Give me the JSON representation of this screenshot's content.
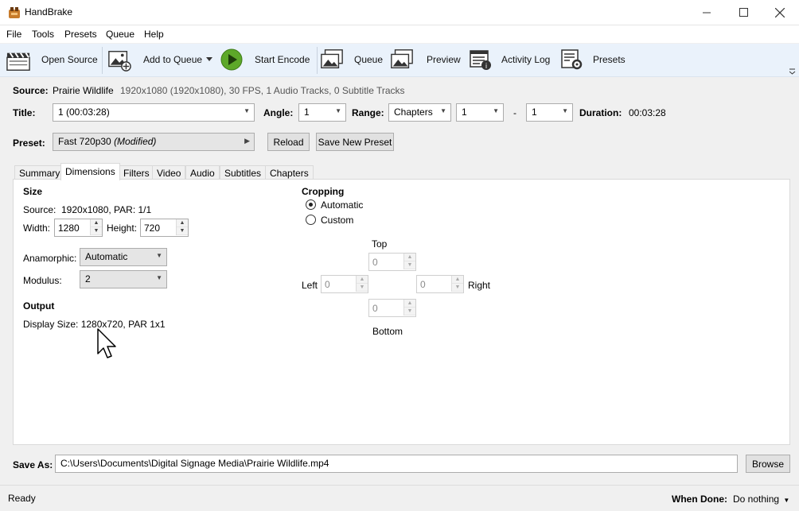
{
  "window": {
    "title": "HandBrake"
  },
  "menu": [
    "File",
    "Tools",
    "Presets",
    "Queue",
    "Help"
  ],
  "toolbar": {
    "open_source": "Open Source",
    "add_to_queue": "Add to Queue",
    "start_encode": "Start Encode",
    "queue": "Queue",
    "preview": "Preview",
    "activity_log": "Activity Log",
    "presets": "Presets"
  },
  "source": {
    "label": "Source:",
    "name": "Prairie Wildlife",
    "info": "1920x1080 (1920x1080), 30 FPS, 1 Audio Tracks, 0 Subtitle Tracks"
  },
  "title_row": {
    "title_label": "Title:",
    "title_value": "1  (00:03:28)",
    "angle_label": "Angle:",
    "angle_value": "1",
    "range_label": "Range:",
    "range_type": "Chapters",
    "range_start": "1",
    "range_dash": "-",
    "range_end": "1",
    "duration_label": "Duration:",
    "duration_value": "00:03:28"
  },
  "preset": {
    "label": "Preset:",
    "name": "Fast 720p30",
    "modified": "(Modified)",
    "reload": "Reload",
    "save_new": "Save New Preset"
  },
  "tabs": [
    "Summary",
    "Dimensions",
    "Filters",
    "Video",
    "Audio",
    "Subtitles",
    "Chapters"
  ],
  "dimensions": {
    "size_heading": "Size",
    "source_label": "Source:",
    "source_value": "1920x1080, PAR: 1/1",
    "width_label": "Width:",
    "width_value": "1280",
    "height_label": "Height:",
    "height_value": "720",
    "anamorphic_label": "Anamorphic:",
    "anamorphic_value": "Automatic",
    "modulus_label": "Modulus:",
    "modulus_value": "2",
    "output_heading": "Output",
    "display_size": "Display Size: 1280x720,  PAR 1x1"
  },
  "cropping": {
    "heading": "Cropping",
    "automatic": "Automatic",
    "custom": "Custom",
    "top_label": "Top",
    "left_label": "Left",
    "right_label": "Right",
    "bottom_label": "Bottom",
    "top_value": "0",
    "left_value": "0",
    "right_value": "0",
    "bottom_value": "0"
  },
  "save_as": {
    "label": "Save As:",
    "path": "C:\\Users\\Documents\\Digital Signage Media\\Prairie Wildlife.mp4",
    "browse": "Browse"
  },
  "status": {
    "text": "Ready",
    "when_done_label": "When Done:",
    "when_done_value": "Do nothing"
  }
}
